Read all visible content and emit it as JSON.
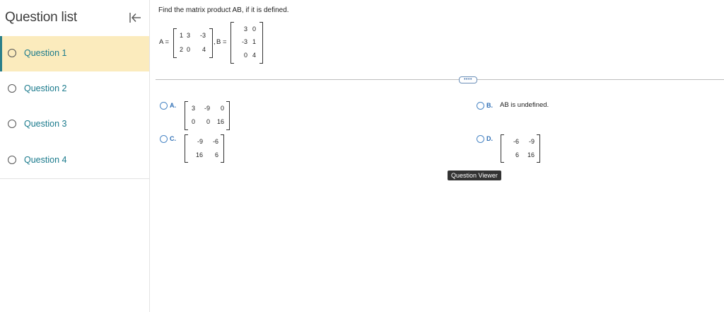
{
  "sidebar": {
    "title": "Question list",
    "collapse_icon": "collapse-left-icon",
    "items": [
      {
        "label": "Question 1",
        "active": true
      },
      {
        "label": "Question 2",
        "active": false
      },
      {
        "label": "Question 3",
        "active": false
      },
      {
        "label": "Question 4",
        "active": false
      }
    ]
  },
  "question": {
    "prompt": "Find the matrix product AB, if it is defined.",
    "matrix_a": {
      "label": "A =",
      "rows": [
        [
          "1",
          "3",
          "-3"
        ],
        [
          "2",
          "0",
          "4"
        ]
      ],
      "suffix": ","
    },
    "matrix_b": {
      "label": "B =",
      "rows": [
        [
          "3",
          "0"
        ],
        [
          "-3",
          "1"
        ],
        [
          "0",
          "4"
        ]
      ]
    }
  },
  "more_button": "••••",
  "options": [
    {
      "letter": "A.",
      "matrix": [
        [
          "3",
          "-9",
          "0"
        ],
        [
          "0",
          "0",
          "16"
        ]
      ]
    },
    {
      "letter": "B.",
      "text": "AB is undefined."
    },
    {
      "letter": "C.",
      "matrix": [
        [
          "-9",
          "-6"
        ],
        [
          "16",
          "6"
        ]
      ]
    },
    {
      "letter": "D.",
      "matrix": [
        [
          "-6",
          "-9"
        ],
        [
          "6",
          "16"
        ]
      ]
    }
  ],
  "tooltip": "Question Viewer",
  "colors": {
    "accent": "#1a7a8c",
    "active_bg": "#fbebbd",
    "option_blue": "#2f6fb5"
  }
}
